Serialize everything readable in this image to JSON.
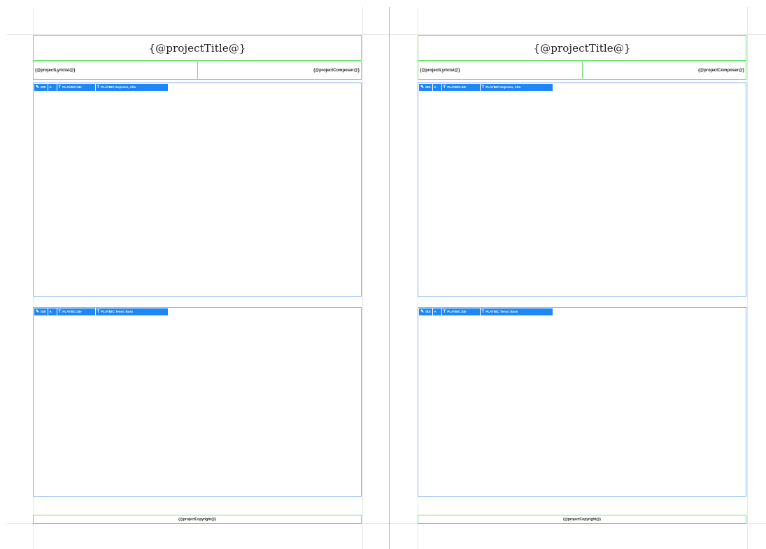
{
  "pages": [
    {
      "title": "{@projectTitle@}",
      "lyricist": "{@projectLyricist@}",
      "composer": "{@projectComposer@}",
      "score_frames": [
        {
          "toolbar": {
            "edit_label": "SDI",
            "flat_label": "A",
            "text_label_1": "PLAYBIC:4B-",
            "text_label_2": "PLAYBIC:Soprano, Alto"
          }
        },
        {
          "toolbar": {
            "edit_label": "SDI",
            "flat_label": "A",
            "text_label_1": "PLAYBIC:4B-",
            "text_label_2": "PLAYBIC:Tenor, Bass"
          }
        }
      ],
      "footer": "{@projectCopyright@}"
    },
    {
      "title": "{@projectTitle@}",
      "lyricist": "{@projectLyricist@}",
      "composer": "{@projectComposer@}",
      "score_frames": [
        {
          "toolbar": {
            "edit_label": "SDI",
            "flat_label": "A",
            "text_label_1": "PLAYBIC:4B-",
            "text_label_2": "PLAYBIC:Soprano, Alto"
          }
        },
        {
          "toolbar": {
            "edit_label": "SDI",
            "flat_label": "A",
            "text_label_1": "PLAYBIC:4B-",
            "text_label_2": "PLAYBIC:Tenor, Bass"
          }
        }
      ],
      "footer": "{@projectCopyright@}"
    }
  ],
  "icons": {
    "edit": "pencil-icon",
    "text": "text-icon"
  },
  "colors": {
    "green_frame": "#72dd77",
    "blue_frame": "#78aef4",
    "blue_chip": "#1f86f7",
    "guide": "#e7e7e7",
    "divider": "#9fc4b3"
  }
}
